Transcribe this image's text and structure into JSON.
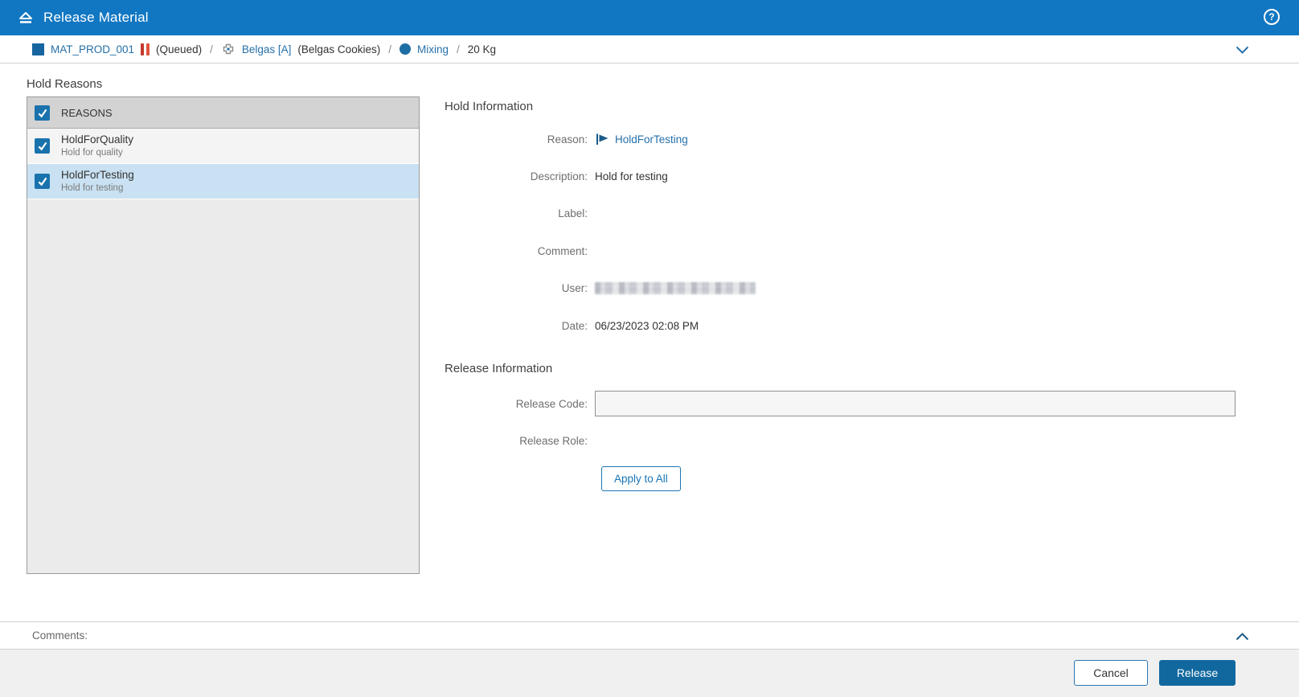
{
  "header": {
    "title": "Release Material"
  },
  "breadcrumb": {
    "material_label": "MAT_PROD_001",
    "status": "(Queued)",
    "separator": "/",
    "equipment_label": "Belgas [A]",
    "equipment_description": "(Belgas Cookies)",
    "operation_label": "Mixing",
    "quantity": "20 Kg"
  },
  "hold_reasons": {
    "title": "Hold Reasons",
    "header_label": "REASONS",
    "header_checked": true,
    "items": [
      {
        "name": "HoldForQuality",
        "description": "Hold for quality",
        "checked": true,
        "selected": false
      },
      {
        "name": "HoldForTesting",
        "description": "Hold for testing",
        "checked": true,
        "selected": true
      }
    ]
  },
  "hold_information": {
    "title": "Hold Information",
    "fields": {
      "reason": {
        "label": "Reason:",
        "value": "HoldForTesting"
      },
      "description": {
        "label": "Description:",
        "value": "Hold for testing"
      },
      "label": {
        "label": "Label:",
        "value": ""
      },
      "comment": {
        "label": "Comment:",
        "value": ""
      },
      "user": {
        "label": "User:",
        "value_redacted": true
      },
      "date": {
        "label": "Date:",
        "value": "06/23/2023 02:08 PM"
      }
    }
  },
  "release_information": {
    "title": "Release Information",
    "release_code": {
      "label": "Release Code:",
      "value": ""
    },
    "release_role": {
      "label": "Release Role:",
      "value": ""
    },
    "apply_button": "Apply to All"
  },
  "comments": {
    "label": "Comments:"
  },
  "footer": {
    "cancel": "Cancel",
    "release": "Release"
  },
  "colors": {
    "header_bg": "#1177c2",
    "link_blue": "#2570a9",
    "release_button": "#11689f",
    "checkbox_blue": "#1a72ad",
    "selected_row": "#c9e1f2",
    "status_red": "#c23b2e",
    "flag_navy": "#1b5a88"
  }
}
